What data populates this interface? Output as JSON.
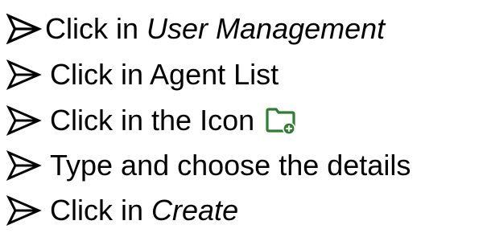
{
  "steps": [
    {
      "prefix": "Click in ",
      "emphasis": "User Management",
      "suffix": ""
    },
    {
      "prefix": "Click in Agent List",
      "emphasis": "",
      "suffix": ""
    },
    {
      "prefix": "Click in the Icon",
      "emphasis": "",
      "suffix": "",
      "icon": "folder-add-icon"
    },
    {
      "prefix": "Type and choose the details",
      "emphasis": "",
      "suffix": ""
    },
    {
      "prefix": "Click in ",
      "emphasis": "Create",
      "suffix": ""
    }
  ],
  "colors": {
    "text": "#000000",
    "icon": "#2e7d32"
  }
}
